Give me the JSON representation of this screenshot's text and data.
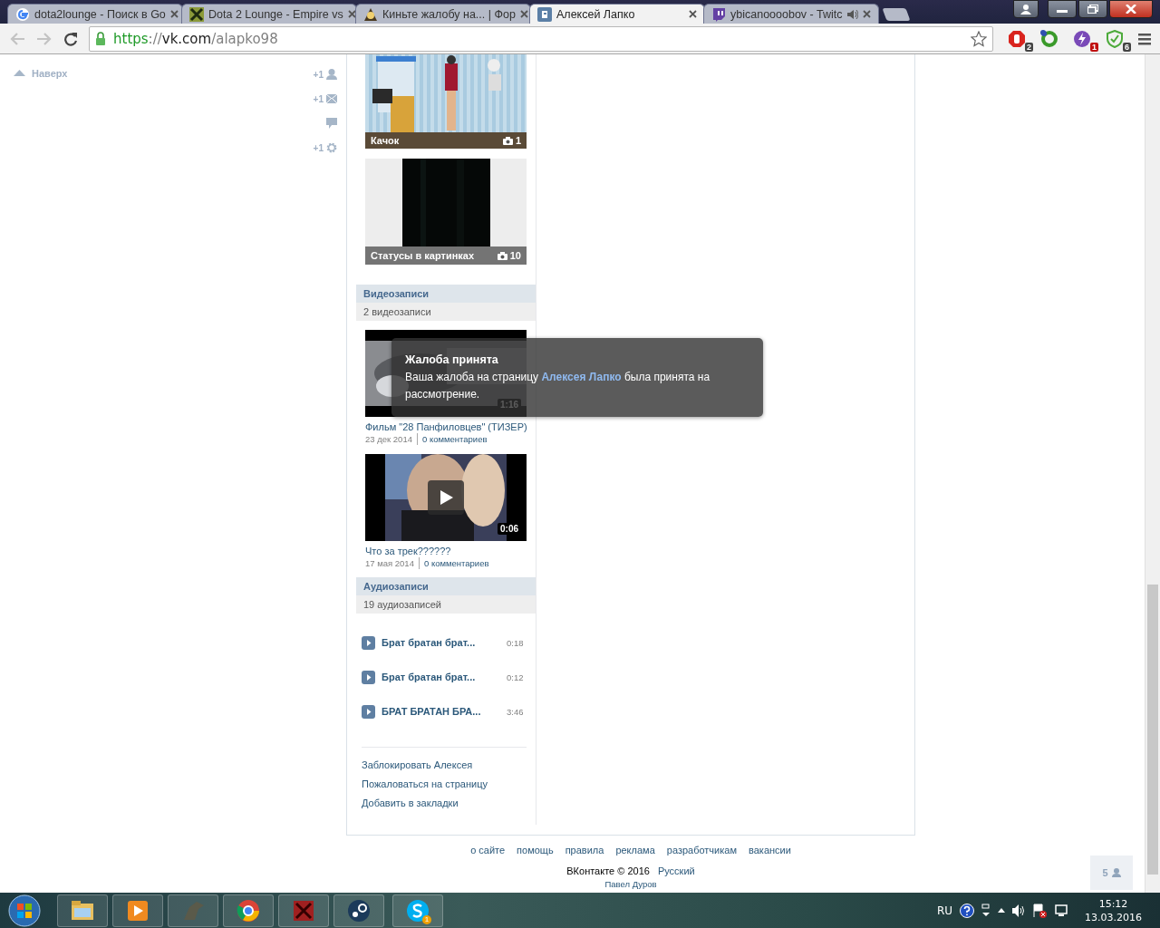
{
  "browser": {
    "tabs": [
      {
        "title": "dota2lounge - Поиск в Go",
        "selected": false,
        "audible": false
      },
      {
        "title": "Dota 2 Lounge - Empire vs",
        "selected": false,
        "audible": false
      },
      {
        "title": "Киньте жалобу на... | Фор",
        "selected": false,
        "audible": false
      },
      {
        "title": "Алексей Лапко",
        "selected": true,
        "audible": false
      },
      {
        "title": "ybicanoooobov - Twitc",
        "selected": false,
        "audible": true
      }
    ],
    "address": {
      "scheme": "https",
      "separator": "://",
      "host": "vk.com",
      "path": "/alapko98"
    },
    "extensions": [
      {
        "badge": "2",
        "alert": false
      },
      {
        "alert": true
      },
      {
        "badge": "1",
        "alert": false
      },
      {
        "badge": "6",
        "alert": false
      }
    ]
  },
  "side": {
    "up_label": "Наверх",
    "counters": [
      {
        "kind": "friends",
        "count": "+1"
      },
      {
        "kind": "messages",
        "count": "+1"
      },
      {
        "kind": "comments"
      },
      {
        "kind": "settings",
        "count": "+1"
      }
    ]
  },
  "albums": [
    {
      "title": "Качок",
      "count": "1"
    },
    {
      "title": "Статусы в картинках",
      "count": "10"
    }
  ],
  "videos": {
    "title": "Видеозаписи",
    "subtitle": "2 видеозаписи",
    "items": [
      {
        "title": "Фильм \"28 Панфиловцев\" (ТИЗЕР)",
        "duration": "1:16",
        "date": "23 дек 2014",
        "comments": "0 комментариев",
        "play_button": false
      },
      {
        "title": "Что за трек??????",
        "duration": "0:06",
        "date": "17 мая 2014",
        "comments": "0 комментариев",
        "play_button": true
      }
    ]
  },
  "audio": {
    "title": "Аудиозаписи",
    "subtitle": "19 аудиозаписей",
    "items": [
      {
        "title": "Брат братан брат...",
        "duration": "0:18"
      },
      {
        "title": "Брат братан брат...",
        "duration": "0:12"
      },
      {
        "title": "БРАТ БРАТАН БРА...",
        "duration": "3:46"
      }
    ]
  },
  "actions": [
    "Заблокировать Алексея",
    "Пожаловаться на страницу",
    "Добавить в закладки"
  ],
  "footer": {
    "links": [
      "о сайте",
      "помощь",
      "правила",
      "реклама",
      "разработчикам",
      "вакансии"
    ],
    "copyright": "ВКонтакте © 2016",
    "language": "Русский",
    "author": "Павел Дуров"
  },
  "online_button": {
    "count": "5"
  },
  "notification": {
    "title": "Жалоба принята",
    "text_before": "Ваша жалоба на страницу",
    "link": "Алексея Лапко",
    "text_after": "была принята на рассмотрение."
  },
  "taskbar": {
    "apps": [
      {
        "kind": "explorer"
      },
      {
        "kind": "media"
      },
      {
        "kind": "game"
      },
      {
        "kind": "chrome"
      },
      {
        "kind": "dota"
      },
      {
        "kind": "steam"
      },
      {
        "kind": "skype",
        "badge": "1"
      }
    ],
    "language": "RU",
    "time": "15:12",
    "date": "13.03.2016"
  }
}
